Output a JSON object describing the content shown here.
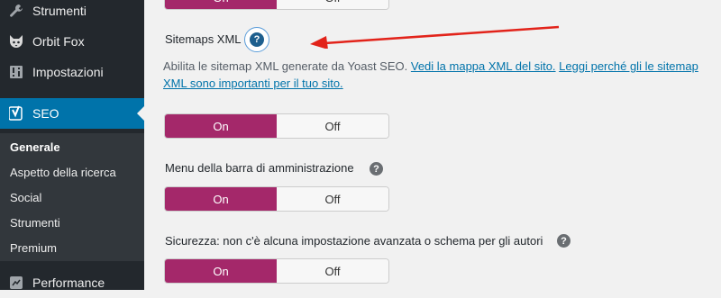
{
  "sidebar": {
    "items": [
      {
        "label": "Strumenti",
        "icon": "wrench-icon"
      },
      {
        "label": "Orbit Fox",
        "icon": "fox-icon"
      },
      {
        "label": "Impostazioni",
        "icon": "settings-icon"
      },
      {
        "label": "SEO",
        "icon": "yoast-icon"
      },
      {
        "label": "Performance",
        "icon": "performance-icon"
      }
    ],
    "submenu": [
      "Generale",
      "Aspetto della ricerca",
      "Social",
      "Strumenti",
      "Premium"
    ],
    "active_item": "SEO",
    "current_subitem": "Generale"
  },
  "main": {
    "top_toggle": {
      "on_label": "On",
      "off_label": "Off"
    },
    "sitemap": {
      "title": "Sitemaps XML",
      "help_symbol": "?",
      "description": "Abilita le sitemap XML generate da Yoast SEO.",
      "link1": "Vedi la mappa XML del sito.",
      "link2a": "Leggi perché gli le sitemap",
      "link2b": "XML sono importanti per il tuo sito.",
      "on_label": "On",
      "off_label": "Off"
    },
    "admin_bar": {
      "title": "Menu della barra di amministrazione",
      "help_symbol": "?",
      "on_label": "On",
      "off_label": "Off"
    },
    "security": {
      "title": "Sicurezza: non c'è alcuna impostazione avanzata o schema per gli autori",
      "help_symbol": "?",
      "on_label": "On",
      "off_label": "Off"
    }
  },
  "colors": {
    "sidebar_bg": "#23282d",
    "active_bg": "#0073aa",
    "toggle_on": "#a4286a",
    "arrow": "#e2231a",
    "link": "#0073aa"
  }
}
